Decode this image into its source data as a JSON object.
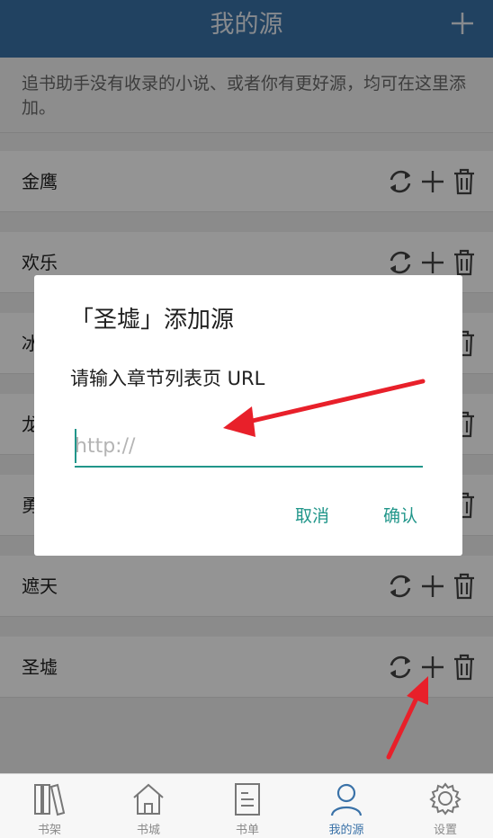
{
  "header": {
    "title": "我的源",
    "add_icon": "plus-icon"
  },
  "notice": "追书助手没有收录的小说、或者你有更好源，均可在这里添加。",
  "sources": [
    {
      "name": "金鹰"
    },
    {
      "name": "欢乐"
    },
    {
      "name": "冰"
    },
    {
      "name": "龙"
    },
    {
      "name": "勇"
    },
    {
      "name": "遮天"
    },
    {
      "name": "圣墟"
    }
  ],
  "dialog": {
    "title": "「圣墟」添加源",
    "message": "请输入章节列表页 URL",
    "input_placeholder": "http://",
    "input_value": "",
    "cancel_label": "取消",
    "confirm_label": "确认"
  },
  "tabs": [
    {
      "label": "书架",
      "icon": "bookshelf-icon"
    },
    {
      "label": "书城",
      "icon": "home-icon"
    },
    {
      "label": "书单",
      "icon": "booklist-icon"
    },
    {
      "label": "我的源",
      "icon": "user-icon",
      "active": true
    },
    {
      "label": "设置",
      "icon": "settings-icon"
    }
  ],
  "colors": {
    "header": "#3a72a8",
    "accent": "#21968a",
    "annotation_arrow": "#e8202a"
  }
}
